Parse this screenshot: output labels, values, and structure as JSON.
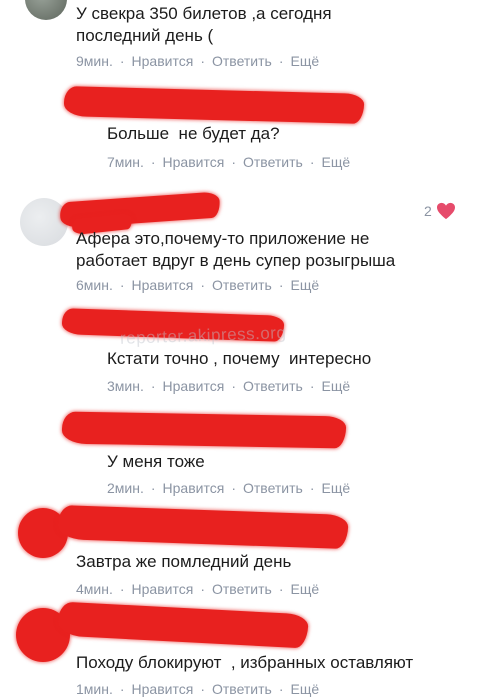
{
  "watermark": "reporter.akipress.org",
  "actions": {
    "like": "Нравится",
    "reply": "Ответить",
    "more": "Ещё"
  },
  "comments": [
    {
      "text": "У свекра 350 билетов ,а сегодня\nпоследний день (",
      "time": "9мин."
    },
    {
      "text": "Больше  не будет да?",
      "time": "7мин."
    },
    {
      "text": "Афера это,почему-то приложение не\nработает вдруг в день супер розыгрыша",
      "time": "6мин.",
      "likes": "2"
    },
    {
      "text": "Кстати точно , почему  интересно",
      "time": "3мин."
    },
    {
      "text": "У меня тоже",
      "time": "2мин."
    },
    {
      "text": "Завтра же помледний день",
      "time": "4мин."
    },
    {
      "text": "Походу блокируют  , избранных оставляют",
      "time": "1мин."
    }
  ],
  "colors": {
    "redaction": "#e8211f",
    "meta": "#8b94a3",
    "heart": "#e64b6b"
  }
}
